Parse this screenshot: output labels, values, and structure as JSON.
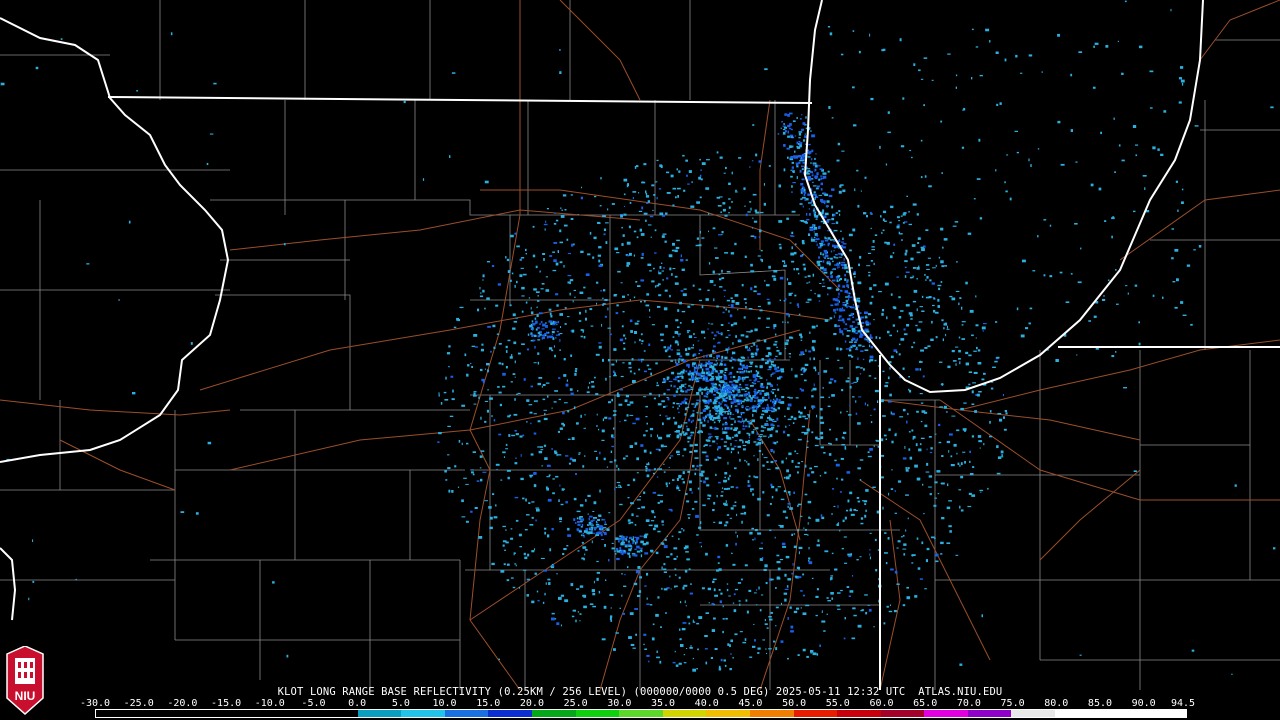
{
  "map": {
    "legend_title": "KLOT LONG RANGE BASE REFLECTIVITY (0.25KM / 256 LEVEL) (000000/0000 0.5 DEG) 2025-05-11 12:32 UTC  ATLAS.NIU.EDU",
    "logo_text": "NIU",
    "scale_ticks": [
      "-30.0",
      "-25.0",
      "-20.0",
      "-15.0",
      "-10.0",
      "-5.0",
      "0.0",
      "5.0",
      "10.0",
      "15.0",
      "20.0",
      "25.0",
      "30.0",
      "35.0",
      "40.0",
      "45.0",
      "50.0",
      "55.0",
      "60.0",
      "65.0",
      "70.0",
      "75.0",
      "80.0",
      "85.0",
      "90.0",
      "94.5"
    ],
    "scale_colors": [
      "#000000",
      "#000000",
      "#000000",
      "#000000",
      "#000000",
      "#000000",
      "#0a9fbf",
      "#21c4e8",
      "#1a70e0",
      "#0b2fd0",
      "#06a81a",
      "#0fd00f",
      "#5cd82a",
      "#d2d600",
      "#f0bd00",
      "#f07e00",
      "#e81d00",
      "#c8000b",
      "#a3002a",
      "#e000e0",
      "#8f00c8",
      "#e8e8e8",
      "#ffffff",
      "#ffffff",
      "#ffffff"
    ],
    "colors": {
      "background": "#000000",
      "state_border": "#ffffff",
      "county_border": "#8a8a8a",
      "highway": "#9b4f2a",
      "echo_light": "#2bb0e0",
      "echo_dense": "#1a60e8"
    }
  }
}
